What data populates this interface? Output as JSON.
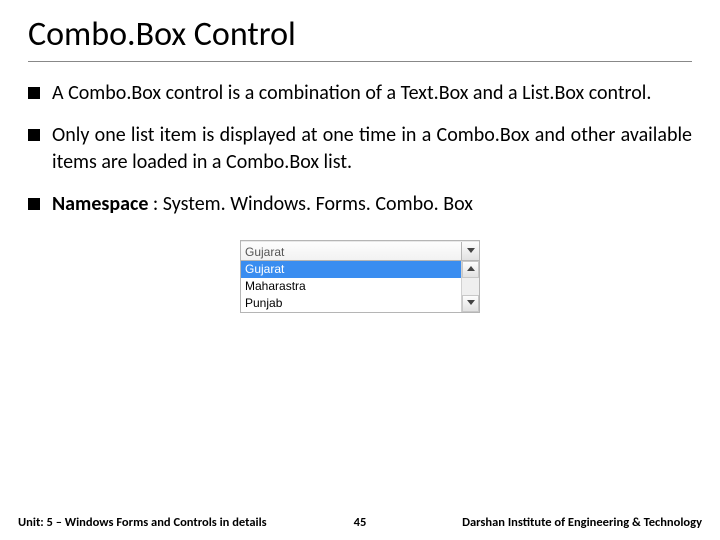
{
  "title": "Combo.Box Control",
  "bullets": [
    "A Combo.Box control is a combination of a Text.Box and a List.Box control.",
    "Only one list item is displayed at one time in a Combo.Box and other available items are loaded in a Combo.Box list."
  ],
  "namespace_label": "Namespace",
  "namespace_value": " : System. Windows. Forms. Combo. Box",
  "combo": {
    "input": "Gujarat",
    "items": [
      "Gujarat",
      "Maharastra",
      "Punjab"
    ],
    "selected_index": 0
  },
  "footer": {
    "unit": "Unit: 5 – Windows Forms and Controls in details",
    "page": "45",
    "institute": "Darshan Institute of Engineering & Technology"
  }
}
